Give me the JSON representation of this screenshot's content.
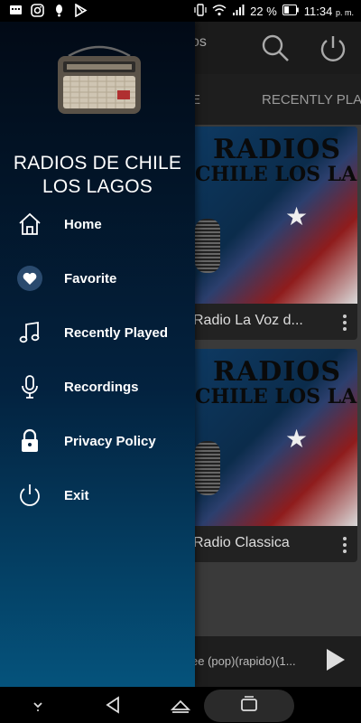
{
  "status_bar": {
    "battery": "22 %",
    "time": "11:34",
    "ampm": "p. m."
  },
  "drawer": {
    "app_name_line1": "RADIOS DE CHILE",
    "app_name_line2": "LOS LAGOS",
    "menu": [
      {
        "label": "Home",
        "icon": "home-icon"
      },
      {
        "label": "Favorite",
        "icon": "heart-icon"
      },
      {
        "label": "Recently Played",
        "icon": "music-note-icon"
      },
      {
        "label": "Recordings",
        "icon": "microphone-icon"
      },
      {
        "label": "Privacy Policy",
        "icon": "lock-icon"
      },
      {
        "label": "Exit",
        "icon": "power-icon"
      }
    ]
  },
  "background": {
    "title_fragment": "os",
    "tab_fragment_1": "E",
    "tab_recent": "RECENTLY PLA",
    "cards": [
      {
        "art_line1": "RADIOS",
        "art_line2": "CHILE LOS LAGOS",
        "name": "Radio La Voz d..."
      },
      {
        "art_line1": "RADIOS",
        "art_line2": "CHILE LOS LAGOS",
        "name": "Radio Classica"
      }
    ],
    "now_playing": "ee (pop)(rapido)(1..."
  },
  "colors": {
    "drawer_top": "#020a16",
    "drawer_bottom": "#05537c",
    "text": "#ffffff"
  }
}
